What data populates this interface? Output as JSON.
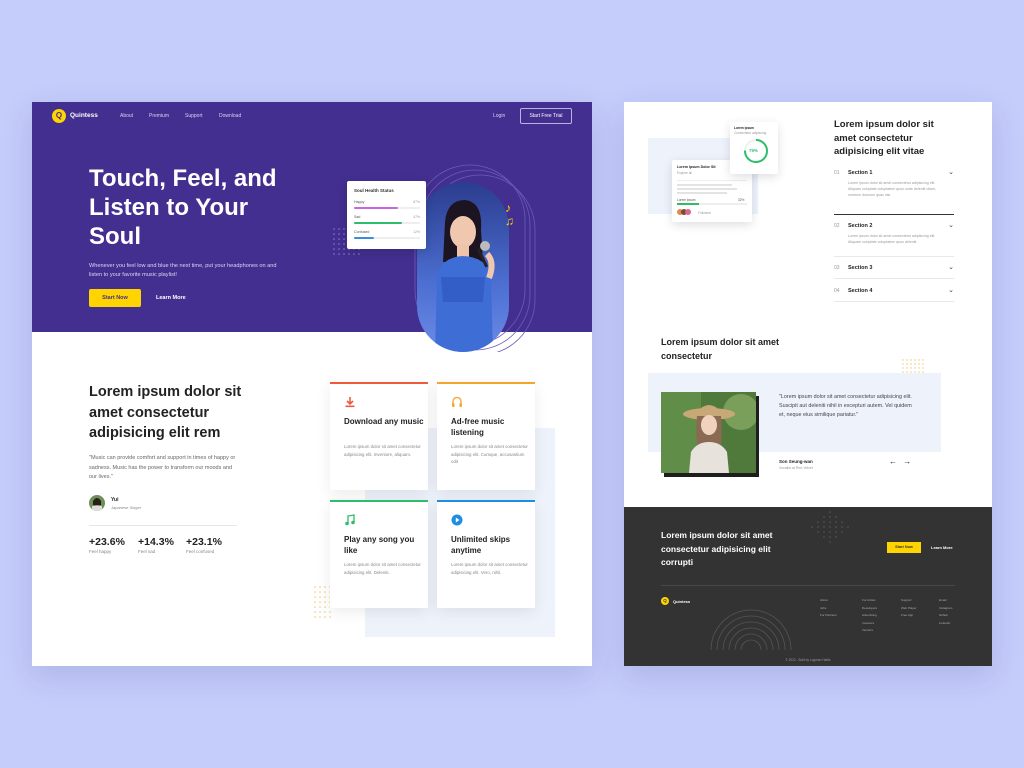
{
  "brand": {
    "logo_letter": "Q",
    "name": "Quintess"
  },
  "nav": {
    "links": [
      "About",
      "Premium",
      "Support",
      "Download"
    ],
    "login": "Login",
    "trial": "Start Free Trial"
  },
  "hero": {
    "title": "Touch, Feel, and Listen to Your Soul",
    "subtitle": "Whenever you feel low and blue the next time, put your headphones on and listen to your favorite music playlist!",
    "primary_cta": "Start Now",
    "secondary_cta": "Learn More"
  },
  "status_card": {
    "title": "Soul Health Status",
    "rows": [
      {
        "label": "Happy",
        "pct": "67%",
        "value": 0.67,
        "color": "#c965e3"
      },
      {
        "label": "Sad",
        "pct": "47%",
        "value": 0.72,
        "color": "#2ebd6b"
      },
      {
        "label": "Confused",
        "pct": "12%",
        "value": 0.3,
        "color": "#3a8dde"
      }
    ]
  },
  "about": {
    "title": "Lorem ipsum dolor sit amet consectetur adipisicing elit rem",
    "quote": "\"Music can provide comfort and support in times of happy or sadness. Music has the power to transform our moods and our lives.\"",
    "author_name": "Yui",
    "author_role": "Japanese Singer",
    "stats": [
      {
        "value": "+23.6%",
        "label": "Feel happy"
      },
      {
        "value": "+14.3%",
        "label": "Feel sad"
      },
      {
        "value": "+23.1%",
        "label": "Feel confused"
      }
    ]
  },
  "features": [
    {
      "title": "Download any music",
      "desc": "Lorem ipsum dolor sit amet consectetur adipisicing elit. Inventore, aliquam.",
      "color": "#ee5a3b",
      "icon": "download-icon"
    },
    {
      "title": "Ad-free music listening",
      "desc": "Lorem ipsum dolor sit amet consectetur adipisicing elit. Cumque, accusantium odit",
      "color": "#f4a52c",
      "icon": "headphones-icon"
    },
    {
      "title": "Play any song you like",
      "desc": "Lorem ipsum dolor sit amet consectetur adipisicing elit. Deleniti.",
      "color": "#2ebd6b",
      "icon": "music-note-icon"
    },
    {
      "title": "Unlimited skips anytime",
      "desc": "Lorem ipsum dolor sit amet consectetur adipisicing elit. Vero, nihil.",
      "color": "#1d8fe0",
      "icon": "play-icon"
    }
  ],
  "mockup": {
    "card1_title": "Lorem Ipsum Dolor Sit",
    "card1_sub": "Explore all",
    "card1_bar_label": "Lorem ipsum",
    "card1_bar_pct": "32%",
    "card1_members": "Followed",
    "card2_title": "Lorem ipsum",
    "card2_sub": "Consectetur adipiscing",
    "card2_value": "75%"
  },
  "faq": {
    "title": "Lorem ipsum dolor sit amet consectetur adipisicing elit vitae",
    "items": [
      {
        "num": "01",
        "head": "Section 1",
        "body": "Lorem ipsum dolor sit amet consectetur adipisicing elit. Aliquam voluptate voluptatem quos unde deleniti ullam, nostrum dolorum quas nisi."
      },
      {
        "num": "02",
        "head": "Section 2",
        "body": "Lorem ipsum dolor sit amet consectetur adipisicing elit. Aliquam voluptate voluptatem quos deleniti."
      },
      {
        "num": "03",
        "head": "Section 3",
        "body": ""
      },
      {
        "num": "04",
        "head": "Section 4",
        "body": ""
      }
    ]
  },
  "testimonial": {
    "title": "Lorem ipsum dolor sit amet consectetur",
    "quote": "\"Lorem ipsum dolor sit amet consectetur adipisicing elit. Suscipit aut deleniti nihil in excepturi autem. Vel quidem et, neque eius similique pariatur.\"",
    "name": "Son Seung-wan",
    "role": "Vocalist at Red Velvet",
    "arrows": "← →"
  },
  "footer": {
    "title": "Lorem ipsum dolor sit amet consectetur adipisicing elit corrupti",
    "start": "Start Now",
    "learn": "Learn More",
    "cols": [
      [
        "About",
        "Jobs",
        "For Partners"
      ],
      [
        "For Artists",
        "Developers",
        "Advertising",
        "Investors",
        "Vendors"
      ],
      [
        "Support",
        "Web Player",
        "Free App"
      ],
      [
        "Email",
        "Instagram",
        "Github",
        "LinkedIn"
      ]
    ],
    "copyright": "© 2022 - Built by Lugman Harits"
  }
}
